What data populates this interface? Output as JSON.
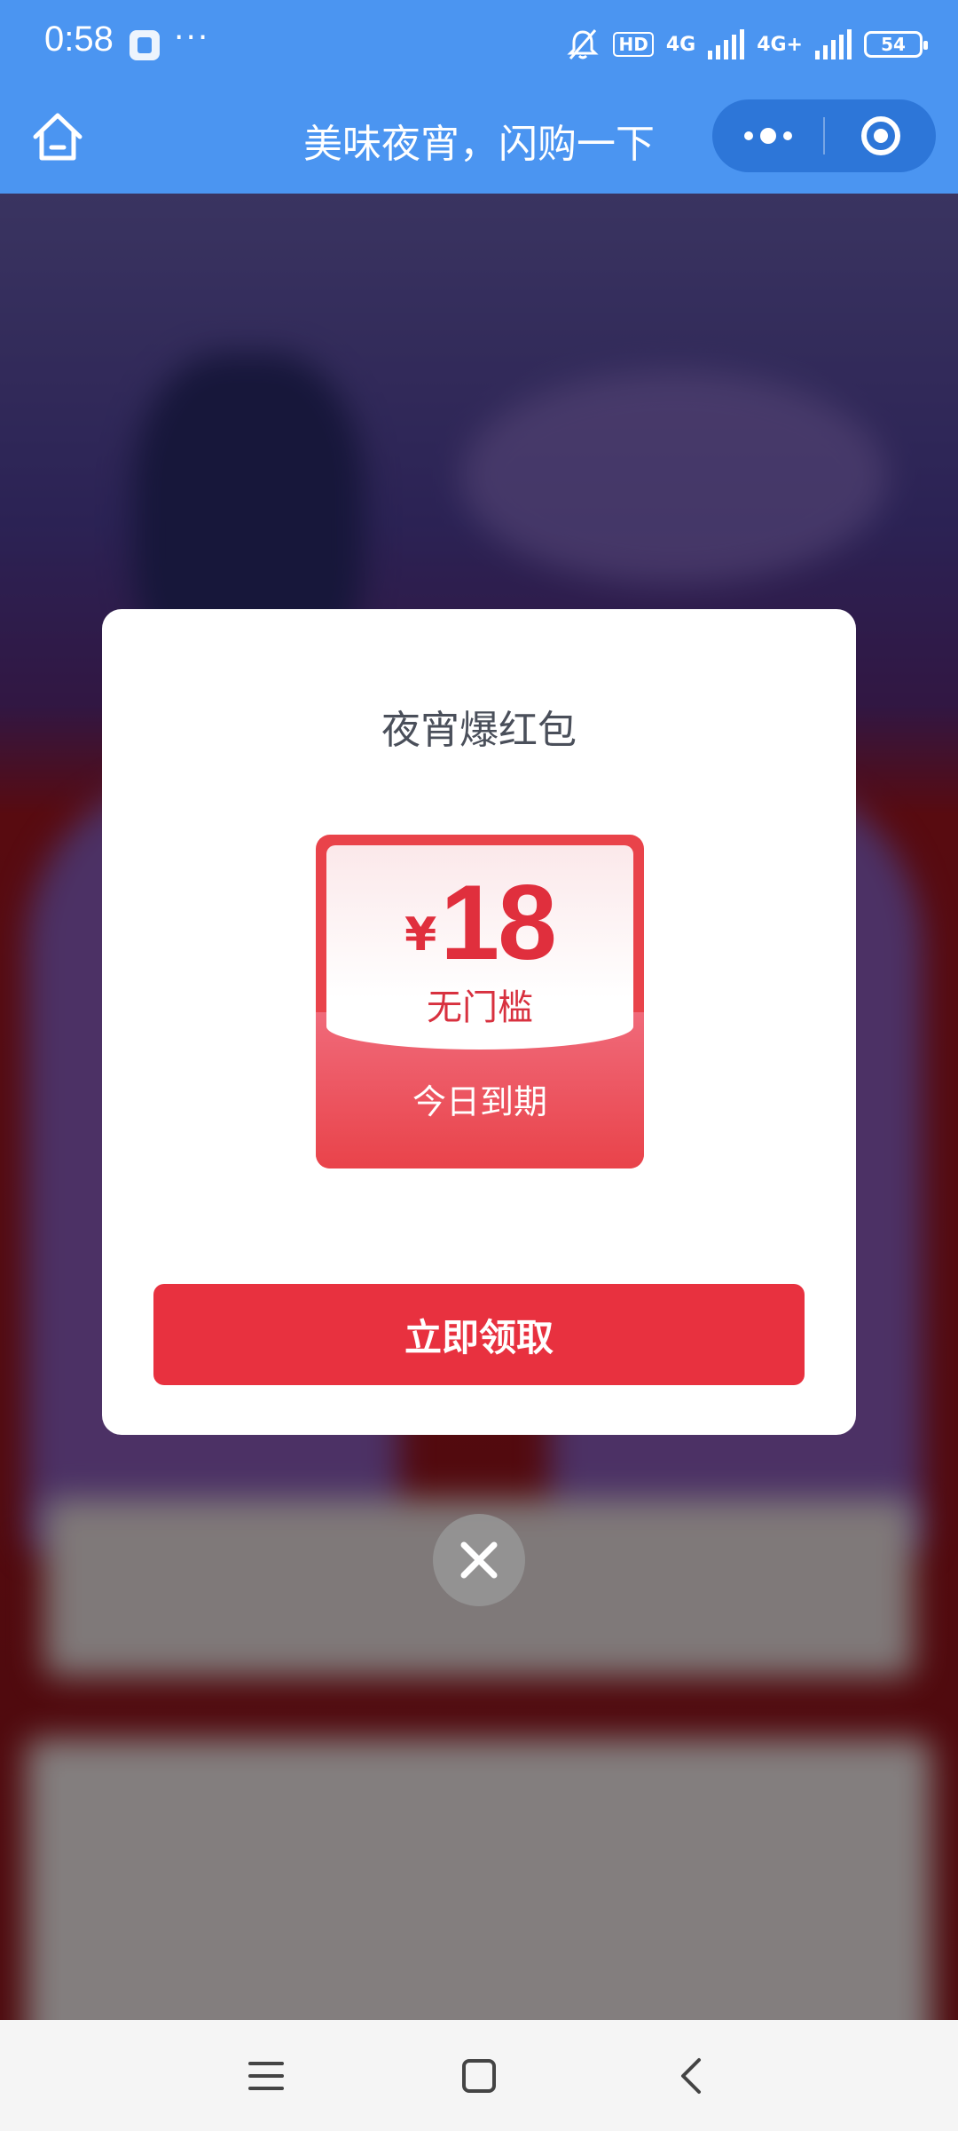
{
  "status_bar": {
    "time": "0:58",
    "more": "···",
    "hd": "HD",
    "net1": "4G",
    "net2": "4G+",
    "battery": "54"
  },
  "nav": {
    "title": "美味夜宵，闪购一下",
    "icons": {
      "home": "home-icon",
      "more": "more-dots-icon",
      "target": "target-icon"
    }
  },
  "modal": {
    "title": "夜宵爆红包",
    "coupon": {
      "currency": "¥",
      "amount": "18",
      "threshold": "无门槛",
      "expiry": "今日到期"
    },
    "claim_label": "立即领取",
    "close_icon": "close-icon"
  },
  "system_nav": {
    "icons": [
      "menu-icon",
      "home-square-icon",
      "back-icon"
    ]
  },
  "colors": {
    "header": "#4b95f1",
    "accent": "#e8313f",
    "coupon": "#e9434a"
  }
}
